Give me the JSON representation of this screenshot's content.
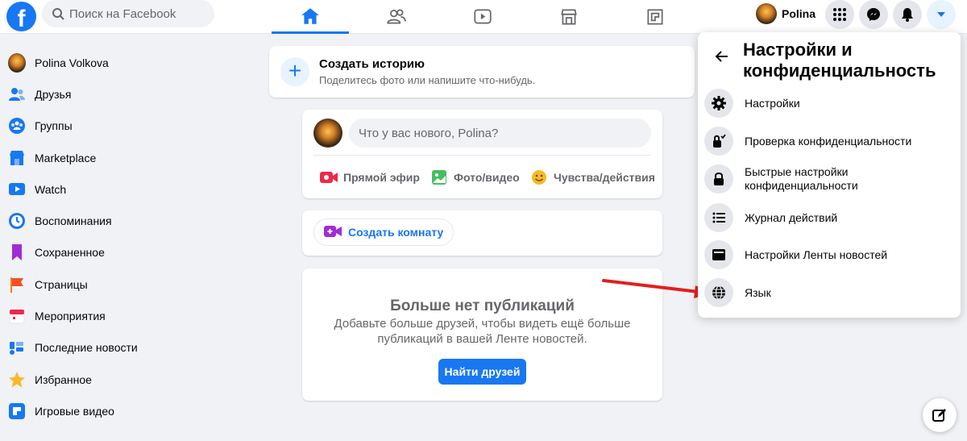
{
  "topbar": {
    "search_placeholder": "Поиск на Facebook",
    "profile_name": "Polina",
    "nav_tabs": [
      "home",
      "friends",
      "watch",
      "marketplace",
      "gaming"
    ]
  },
  "sidebar": {
    "items": [
      {
        "label": "Polina Volkova",
        "icon": "avatar"
      },
      {
        "label": "Друзья",
        "icon": "friends-icon"
      },
      {
        "label": "Группы",
        "icon": "groups-icon"
      },
      {
        "label": "Marketplace",
        "icon": "marketplace-icon"
      },
      {
        "label": "Watch",
        "icon": "watch-icon"
      },
      {
        "label": "Воспоминания",
        "icon": "memories-icon"
      },
      {
        "label": "Сохраненное",
        "icon": "saved-icon"
      },
      {
        "label": "Страницы",
        "icon": "pages-icon"
      },
      {
        "label": "Мероприятия",
        "icon": "events-icon"
      },
      {
        "label": "Последние новости",
        "icon": "news-icon"
      },
      {
        "label": "Избранное",
        "icon": "star-icon"
      },
      {
        "label": "Игровые видео",
        "icon": "gaming-video-icon"
      }
    ]
  },
  "story": {
    "title": "Создать историю",
    "subtitle": "Поделитесь фото или напишите что-нибудь."
  },
  "composer": {
    "prompt": "Что у вас нового, Polina?",
    "actions": [
      "Прямой эфир",
      "Фото/видео",
      "Чувства/действия"
    ]
  },
  "room": {
    "label": "Создать комнату"
  },
  "empty_feed": {
    "title": "Больше нет публикаций",
    "text": "Добавьте больше друзей, чтобы видеть ещё больше публикаций в вашей Ленте новостей.",
    "button": "Найти друзей"
  },
  "dropdown": {
    "title": "Настройки и конфиденциальность",
    "items": [
      {
        "label": "Настройки",
        "icon": "gear-icon"
      },
      {
        "label": "Проверка конфиденциальности",
        "icon": "lock-check-icon"
      },
      {
        "label": "Быстрые настройки конфиденциальности",
        "icon": "lock-icon"
      },
      {
        "label": "Журнал действий",
        "icon": "list-icon"
      },
      {
        "label": "Настройки Ленты новостей",
        "icon": "feed-icon"
      },
      {
        "label": "Язык",
        "icon": "globe-icon"
      }
    ]
  },
  "colors": {
    "brand": "#1877f2",
    "annotation": "#e41e1e"
  }
}
